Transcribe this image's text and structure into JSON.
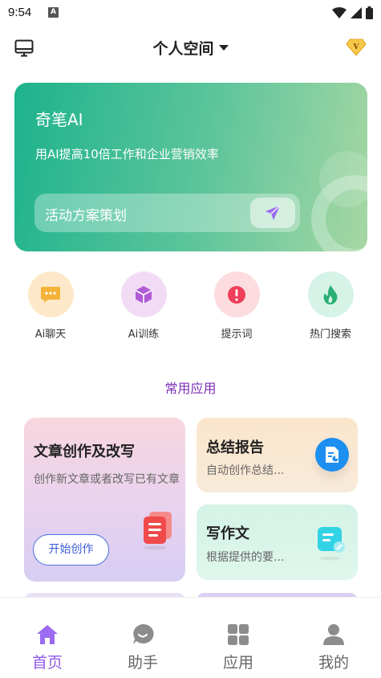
{
  "status_bar": {
    "time": "9:54",
    "notif_letter": "A"
  },
  "header": {
    "title": "个人空间",
    "vip_letter": "V"
  },
  "banner": {
    "title": "奇笔AI",
    "subtitle": "用AI提高10倍工作和企业营销效率",
    "input_placeholder": "活动方案策划"
  },
  "quick_actions": [
    {
      "label": "Ai聊天",
      "icon": "chat-bubble-icon",
      "color": "#fde9c9"
    },
    {
      "label": "Ai训练",
      "icon": "cube-icon",
      "color": "#f2dcf5"
    },
    {
      "label": "提示词",
      "icon": "alert-icon",
      "color": "#fcdcdf"
    },
    {
      "label": "热门搜索",
      "icon": "fire-icon",
      "color": "#d6f3e8"
    }
  ],
  "section_title": "常用应用",
  "apps": [
    {
      "title": "文章创作及改写",
      "desc": "创作新文章或者改写已有文章",
      "button": "开始创作",
      "icon": "document-stack-icon"
    },
    {
      "title": "总结报告",
      "desc": "自动创作总结...",
      "icon": "report-icon"
    },
    {
      "title": "写作文",
      "desc": "根据提供的要...",
      "icon": "note-edit-icon"
    }
  ],
  "tabs": [
    {
      "label": "首页",
      "icon": "home-icon",
      "active": true
    },
    {
      "label": "助手",
      "icon": "assistant-bubble-icon",
      "active": false
    },
    {
      "label": "应用",
      "icon": "grid-icon",
      "active": false
    },
    {
      "label": "我的",
      "icon": "user-icon",
      "active": false
    }
  ],
  "colors": {
    "accent": "#8f5be8",
    "banner_start": "#1db38c",
    "banner_end": "#a6d7a3",
    "section_title": "#7b2fb5"
  }
}
